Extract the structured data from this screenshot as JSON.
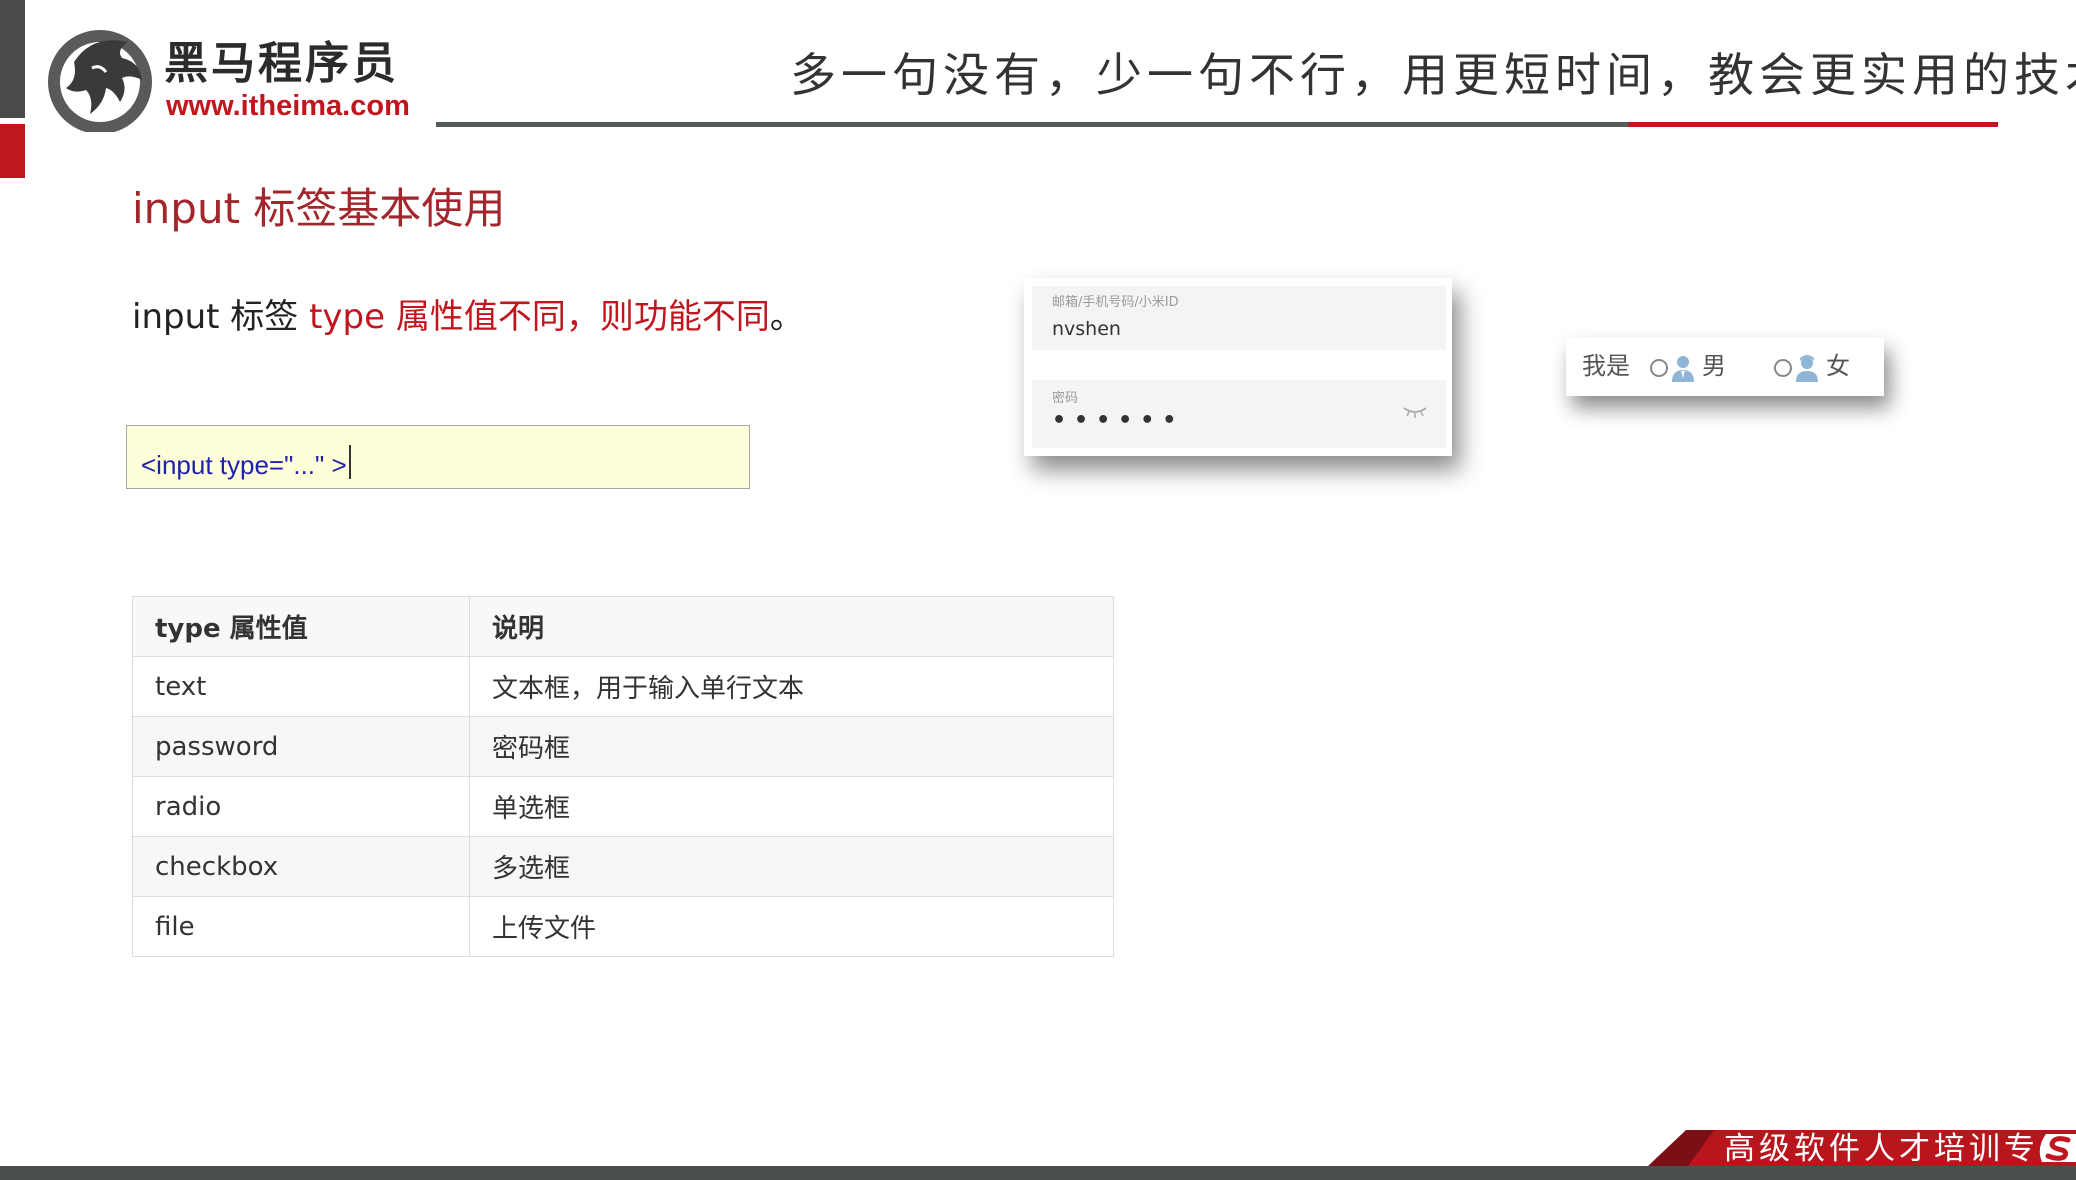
{
  "brand": {
    "name": "黑马程序员",
    "url": "www.itheima.com",
    "slogan": "多一句没有，少一句不行，用更短时间，教会更实用的技术!"
  },
  "slide": {
    "title": "input 标签基本使用",
    "desc_prefix": "input 标签 ",
    "desc_highlight": "type 属性值不同，则功能不同",
    "desc_suffix": "。",
    "code": "<input type=\"...\" >"
  },
  "login_demo": {
    "user_label": "邮箱/手机号码/小米ID",
    "user_value": "nvshen",
    "pass_label": "密码",
    "pass_value": "••••••"
  },
  "gender_demo": {
    "prompt": "我是",
    "male": "男",
    "female": "女"
  },
  "table": {
    "headers": [
      "type 属性值",
      "说明"
    ],
    "rows": [
      [
        "text",
        "文本框，用于输入单行文本"
      ],
      [
        "password",
        "密码框"
      ],
      [
        "radio",
        "单选框"
      ],
      [
        "checkbox",
        "多选框"
      ],
      [
        "file",
        "上传文件"
      ]
    ]
  },
  "footer": {
    "tagline": "高级软件人才培训专"
  },
  "colors": {
    "accent_red": "#c0161e",
    "title_red": "#a2262b",
    "dark_gray": "#4a4a4a"
  }
}
